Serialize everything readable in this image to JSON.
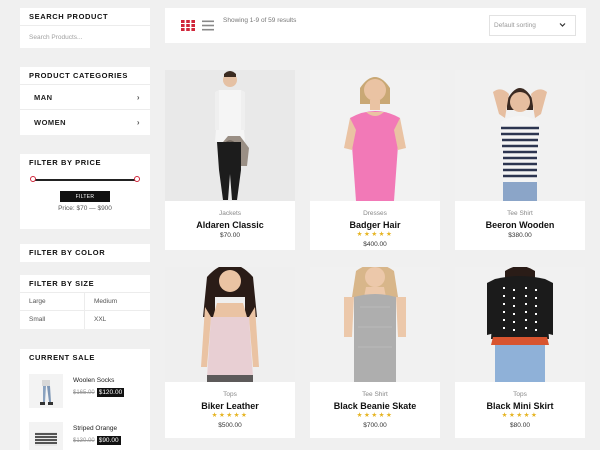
{
  "sidebar": {
    "search": {
      "title": "Search Product",
      "placeholder": "Search Products..."
    },
    "categories": {
      "title": "Product Categories",
      "items": [
        {
          "label": "MAN",
          "arrow": "›"
        },
        {
          "label": "WOMEN",
          "arrow": "›"
        }
      ]
    },
    "price_filter": {
      "title": "Filter By Price",
      "button_label": "FILTER",
      "range_text": "Price: $70 — $900",
      "range_low_fraction": 0.0,
      "range_high_fraction": 1.0
    },
    "color_filter": {
      "title": "Filter By Color"
    },
    "size_filter": {
      "title": "Filter By Size",
      "sizes": [
        "Large",
        "Medium",
        "Small",
        "XXL"
      ]
    },
    "current_sale": {
      "title": "Current Sale",
      "items": [
        {
          "name": "Woolen Socks",
          "old_price": "$165.00",
          "new_price": "$120.00"
        },
        {
          "name": "Striped Orange",
          "old_price": "$130.00",
          "new_price": "$90.00"
        }
      ]
    }
  },
  "toolbar": {
    "result_count": "Showing 1-9 of 59 results",
    "sort_value": "Default sorting",
    "grid_icon": "grid-view-icon",
    "list_icon": "list-view-icon",
    "accent_color": "#d0263a"
  },
  "products": [
    {
      "category": "Jackets",
      "title": "Aldaren Classic",
      "price": "$70.00",
      "stars": "",
      "rating": 0
    },
    {
      "category": "Dresses",
      "title": "Badger Hair",
      "price": "$400.00",
      "stars": "★★★★★",
      "rating": 5
    },
    {
      "category": "Tee Shirt",
      "title": "Beeron Wooden",
      "price": "$380.00",
      "stars": "",
      "rating": 0
    },
    {
      "category": "Tops",
      "title": "Biker Leather",
      "price": "$500.00",
      "stars": "★★★★★",
      "rating": 5
    },
    {
      "category": "Tee Shirt",
      "title": "Black Beanie Skate",
      "price": "$700.00",
      "stars": "★★★★★",
      "rating": 5
    },
    {
      "category": "Tops",
      "title": "Black Mini Skirt",
      "price": "$80.00",
      "stars": "★★★★★",
      "rating": 5
    }
  ]
}
